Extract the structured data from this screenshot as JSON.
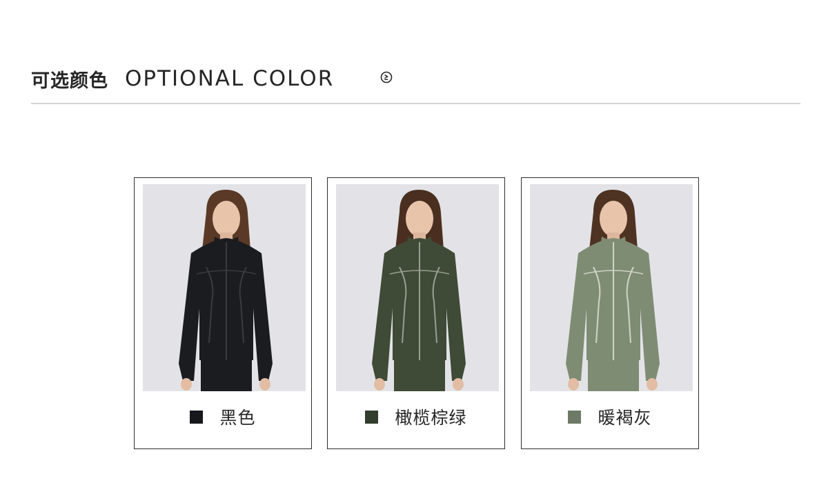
{
  "header": {
    "title_cn": "可选颜色",
    "title_en": "OPTIONAL COLOR",
    "icon": "circle-arrow-right-icon"
  },
  "products": [
    {
      "name": "黑色",
      "swatch_color": "#17181c",
      "jacket_color": "#1b1c20",
      "trim_color": "#3a3b40"
    },
    {
      "name": "橄榄棕绿",
      "swatch_color": "#333d2e",
      "jacket_color": "#3f4a37",
      "trim_color": "#9aa08f"
    },
    {
      "name": "暖褐灰",
      "swatch_color": "#6d7a65",
      "jacket_color": "#7f8c74",
      "trim_color": "#d0d5c6"
    }
  ]
}
